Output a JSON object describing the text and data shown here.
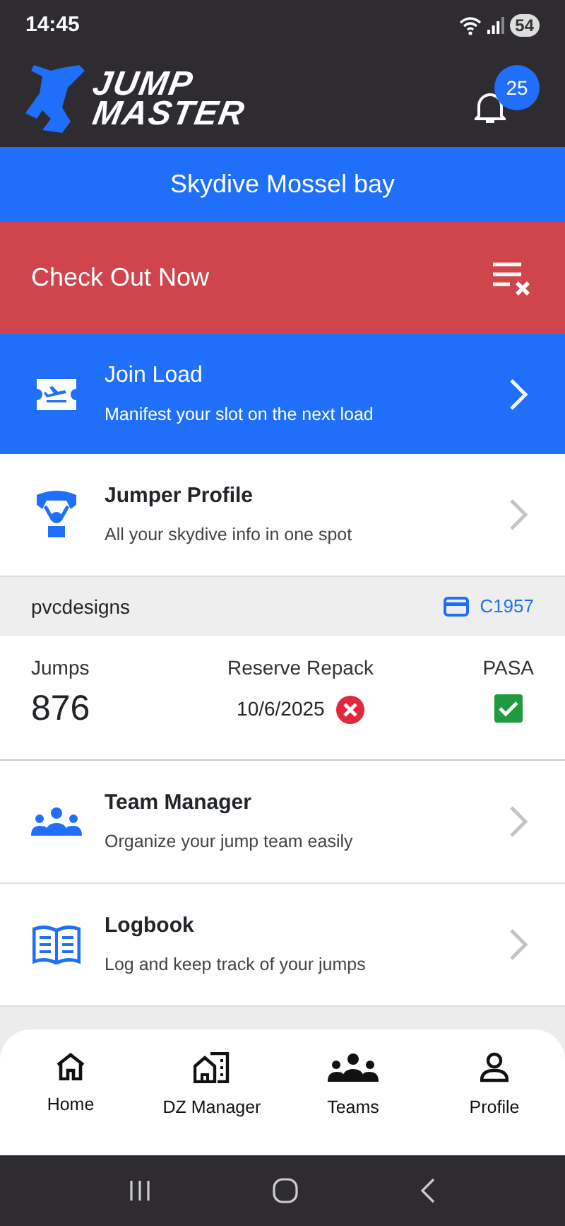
{
  "status_bar": {
    "time": "14:45",
    "battery": "54"
  },
  "header": {
    "logo_line_1": "JUMP",
    "logo_line_2": "MASTER",
    "notifications": "25"
  },
  "dropzone": {
    "name": "Skydive Mossel bay"
  },
  "check_out": {
    "label": "Check Out Now"
  },
  "menu": [
    {
      "kind": "primary",
      "title": "Join Load",
      "subtitle": "Manifest your slot on the next load"
    },
    {
      "kind": "default",
      "title": "Jumper Profile",
      "subtitle": "All your skydive info in one spot"
    }
  ],
  "profile": {
    "username": "pvcdesigns",
    "card_number": "C1957",
    "jumps_label": "Jumps",
    "jumps": "876",
    "repack_label": "Reserve Repack",
    "repack_date": "10/6/2025",
    "repack_valid": false,
    "pasa_label": "PASA",
    "pasa_valid": true
  },
  "menu_2": [
    {
      "kind": "default",
      "title": "Team Manager",
      "subtitle": "Organize your jump team easily"
    },
    {
      "kind": "default",
      "title": "Logbook",
      "subtitle": "Log and keep track of your jumps"
    }
  ],
  "bottom_nav": [
    {
      "label": "Home"
    },
    {
      "label": "DZ Manager"
    },
    {
      "label": "Teams"
    },
    {
      "label": "Profile"
    }
  ]
}
